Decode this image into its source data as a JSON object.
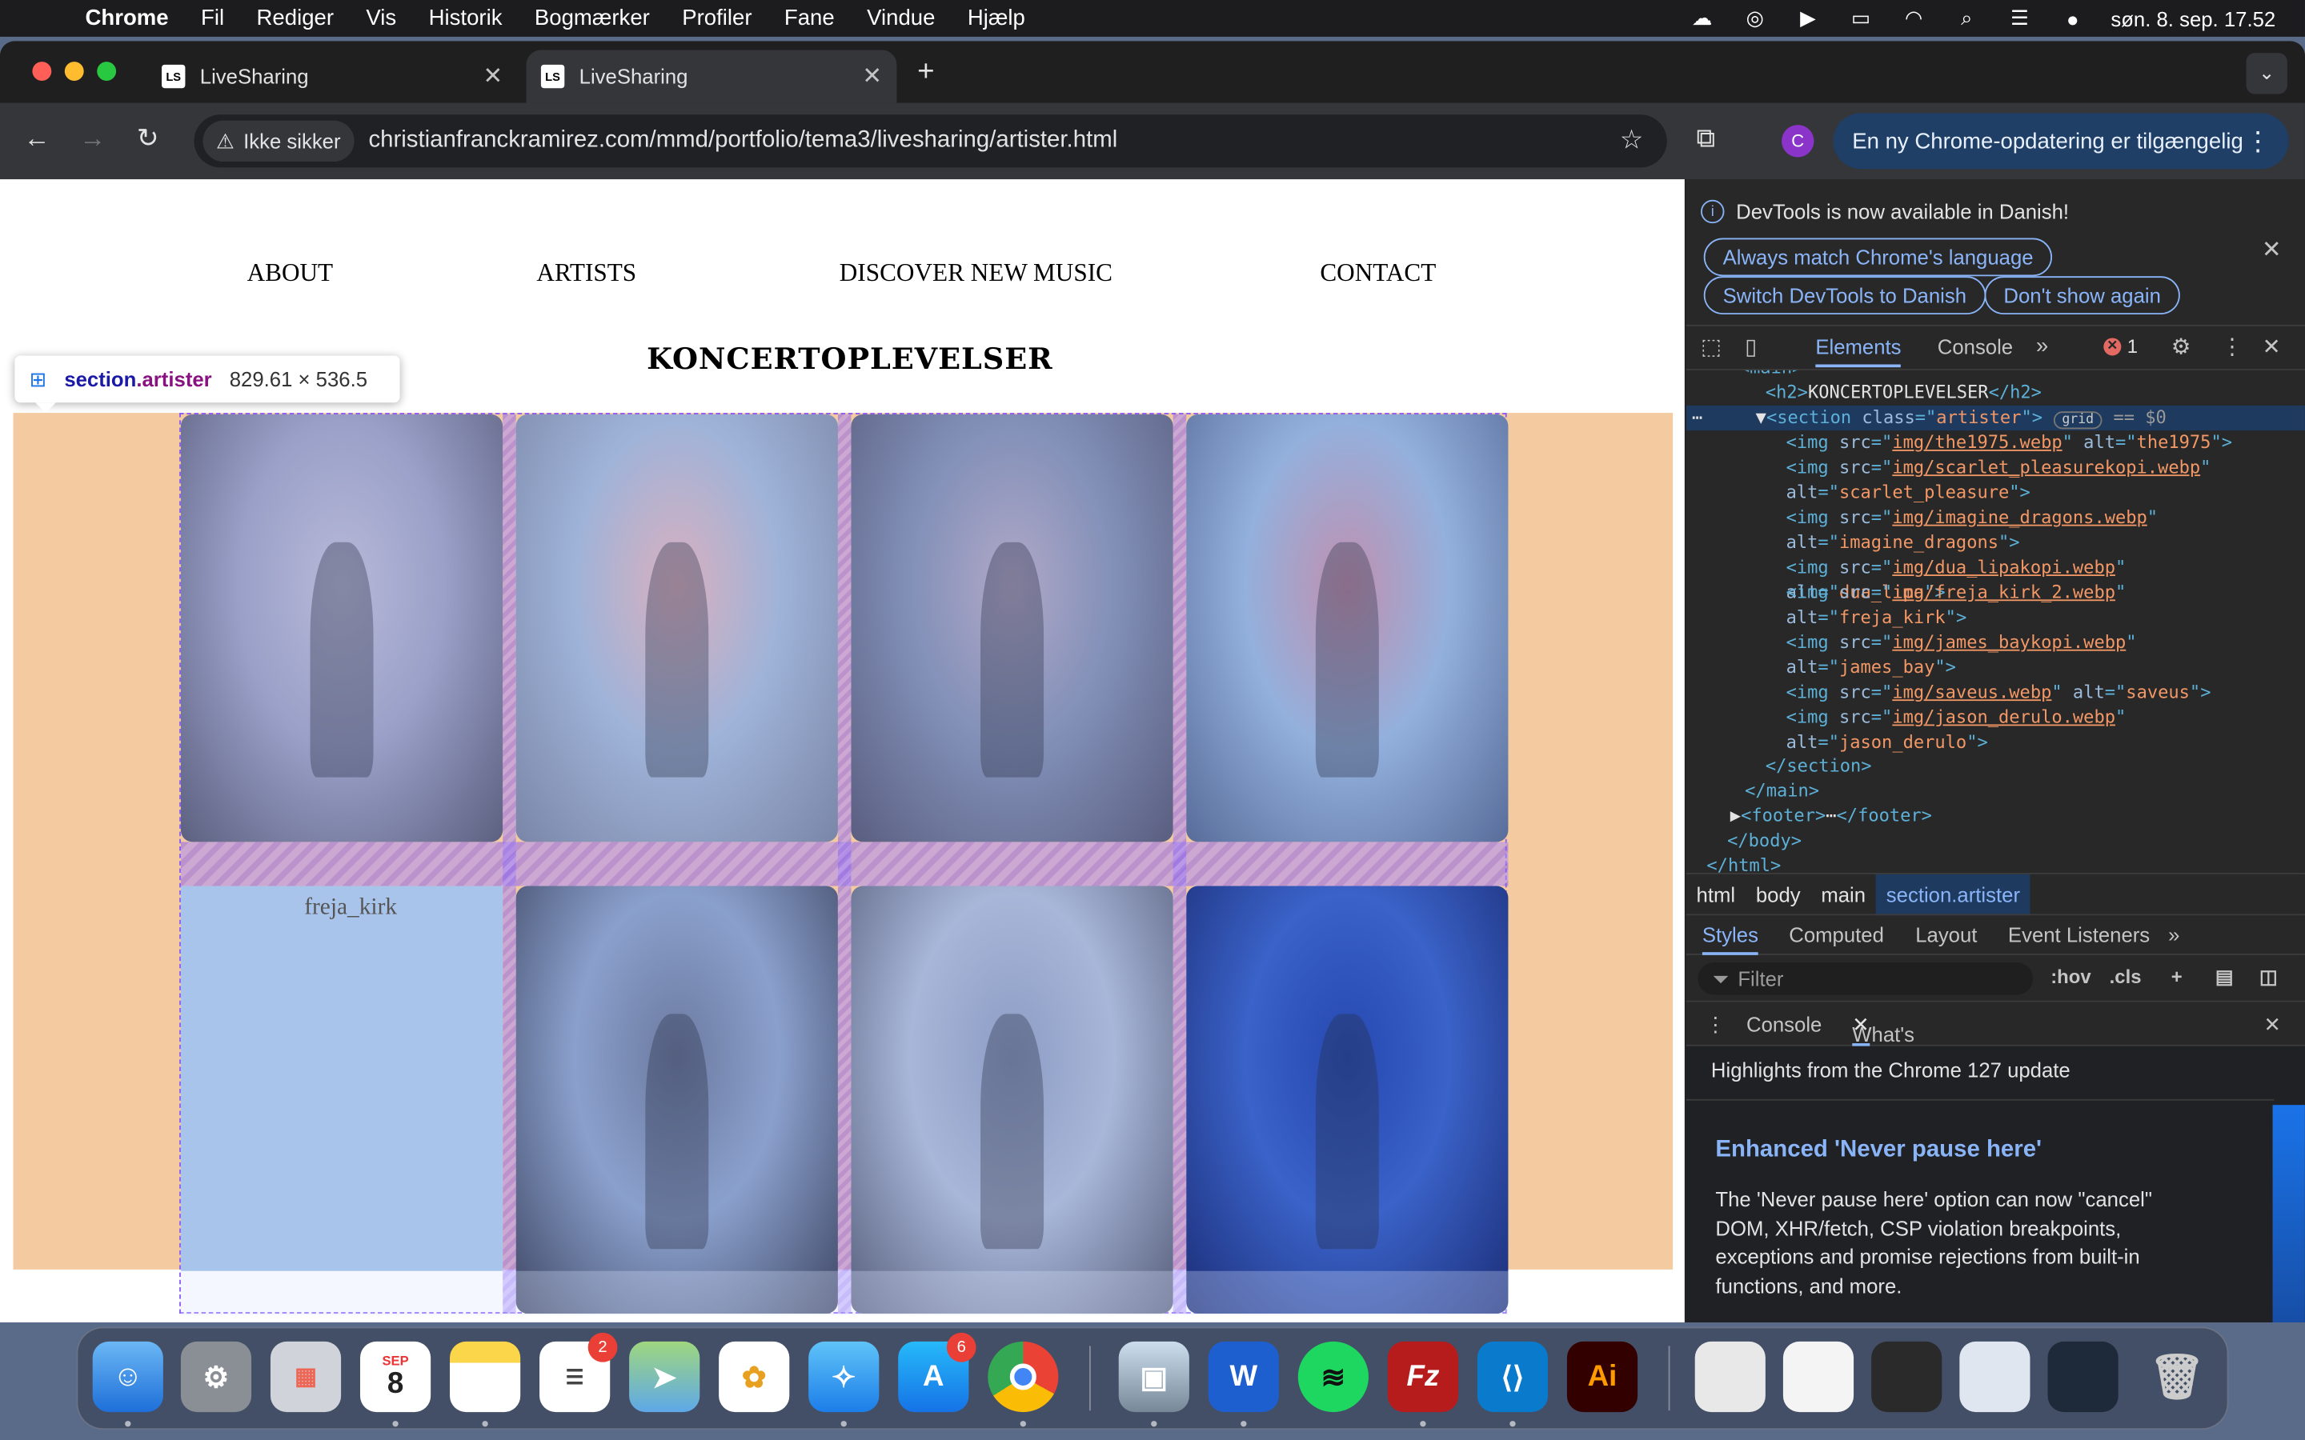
{
  "menubar": {
    "app": "Chrome",
    "items": [
      "Fil",
      "Rediger",
      "Vis",
      "Historik",
      "Bogmærker",
      "Profiler",
      "Fane",
      "Vindue",
      "Hjælp"
    ],
    "clock": "søn. 8. sep.  17.52"
  },
  "tabs": [
    {
      "title": "LiveSharing",
      "favicon": "LS"
    },
    {
      "title": "LiveSharing",
      "favicon": "LS"
    }
  ],
  "toolbar": {
    "security_chip": "Ikke sikker",
    "url": "christianfranckramirez.com/mmd/portfolio/tema3/livesharing/artister.html",
    "profile_initial": "C",
    "update_text": "En ny Chrome-opdatering er tilgængelig"
  },
  "page": {
    "nav": [
      "ABOUT",
      "ARTISTS",
      "DISCOVER NEW MUSIC",
      "CONTACT"
    ],
    "heading": "KONCERTOPLEVELSER",
    "inspect_tooltip": {
      "tag": "section",
      "class": ".artister",
      "size": "829.61 × 536.5"
    },
    "broken_image_alt": "freja_kirk",
    "photos": [
      {
        "alt": "the1975",
        "colors": [
          "#9aa0c8",
          "#b7b9d8",
          "#5c6080"
        ]
      },
      {
        "alt": "scarlet_pleasure",
        "colors": [
          "#9fb3d8",
          "#d8b0c0",
          "#7a86a8"
        ]
      },
      {
        "alt": "imagine_dragons",
        "colors": [
          "#8290b8",
          "#b0a8c8",
          "#5a5e80"
        ]
      },
      {
        "alt": "dua_lipa",
        "colors": [
          "#93b0dc",
          "#c090b0",
          "#586c9a"
        ]
      },
      {
        "alt": "james_bay",
        "colors": [
          "#8aa0cc",
          "#6c7aa0",
          "#404866"
        ]
      },
      {
        "alt": "saveus",
        "colors": [
          "#a8b6d8",
          "#8c9cc4",
          "#58607e"
        ]
      },
      {
        "alt": "jason_derulo",
        "colors": [
          "#3a62c8",
          "#2548b0",
          "#1c2e78"
        ]
      }
    ]
  },
  "devtools": {
    "notice": "DevTools is now available in Danish!",
    "buttons": [
      "Always match Chrome's language",
      "Switch DevTools to Danish",
      "Don't show again"
    ],
    "panel_tabs": [
      "Elements",
      "Console"
    ],
    "error_count": "1",
    "dom": {
      "main": "<main>",
      "h2": "KONCERTOPLEVELSER",
      "section_class": "artister",
      "badge": "grid",
      "dollar": "== $0",
      "imgs": [
        {
          "src": "img/the1975.webp",
          "alt": "the1975"
        },
        {
          "src": "img/scarlet_pleasurekopi.webp",
          "alt": "scarlet_pleasure"
        },
        {
          "src": "img/imagine_dragons.webp",
          "alt": "imagine_dragons"
        },
        {
          "src": "img/dua_lipakopi.webp",
          "alt": "dua_lipa"
        },
        {
          "src": "img/freja_kirk_2.webp",
          "alt": "freja_kirk"
        },
        {
          "src": "img/james_baykopi.webp",
          "alt": "james_bay"
        },
        {
          "src": "img/saveus.webp",
          "alt": "saveus"
        },
        {
          "src": "img/jason_derulo.webp",
          "alt": "jason_derulo"
        }
      ]
    },
    "breadcrumbs": [
      "html",
      "body",
      "main",
      "section.artister"
    ],
    "style_tabs": [
      "Styles",
      "Computed",
      "Layout",
      "Event Listeners"
    ],
    "filter_placeholder": "Filter",
    "filter_opts": [
      ":hov",
      ".cls"
    ],
    "drawer_tabs": [
      "Console",
      "What's new"
    ],
    "whats_new": {
      "highlights": "Highlights from the Chrome 127 update",
      "title": "Enhanced 'Never pause here'",
      "body": "The 'Never pause here' option can now \"cancel\" DOM, XHR/fetch, CSP violation breakpoints, exceptions and promise rejections from built-in functions, and more."
    }
  },
  "dock": {
    "calendar_month": "SEP",
    "calendar_day": "8",
    "reminders_badge": "2",
    "appstore_badge": "6"
  }
}
